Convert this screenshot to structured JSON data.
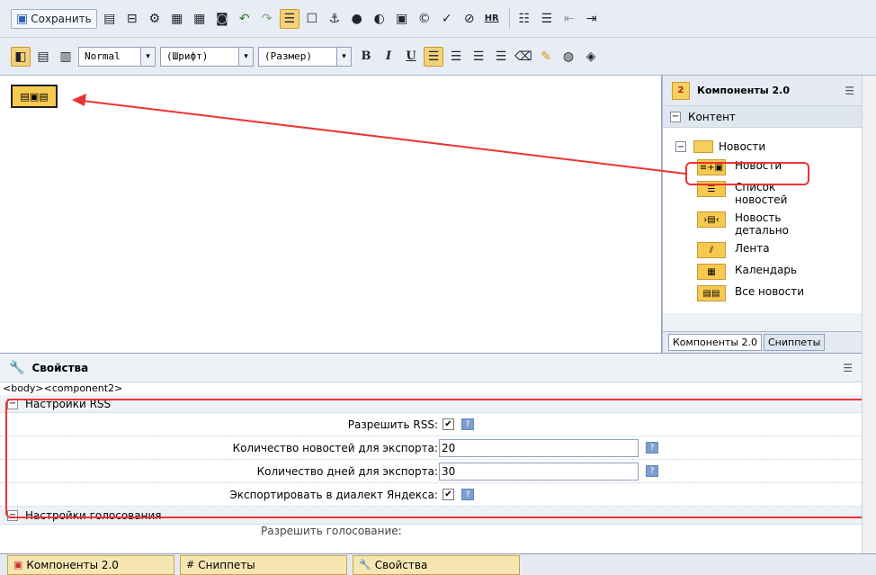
{
  "toolbar1": {
    "save_label": "Сохранить",
    "icons": [
      "snippet-icon",
      "template-icon",
      "settings-icon",
      "page-icon",
      "page-props-icon",
      "preview-icon",
      "undo-icon",
      "redo-icon",
      "component-icon",
      "table-icon",
      "anchor-icon",
      "flash-icon",
      "media-icon",
      "image-icon",
      "copyright-icon",
      "spellcheck-icon",
      "clean-icon",
      "hr-icon",
      "numbered-list-icon",
      "bulleted-list-icon",
      "outdent-icon",
      "indent-icon"
    ],
    "hr_label": "HR"
  },
  "toolbar2": {
    "style_value": "Normal",
    "font_value": "(Шрифт)",
    "size_value": "(Размер)",
    "bold": "B",
    "italic": "I",
    "underline": "U"
  },
  "component_panel": {
    "title": "Компоненты 2.0",
    "section": "Контент",
    "folder": "Новости",
    "items": [
      {
        "label": "Новости",
        "icon": "news-icon"
      },
      {
        "label": "Список новостей",
        "icon": "news-list-icon"
      },
      {
        "label": "Новость детально",
        "icon": "news-detail-icon"
      },
      {
        "label": "Лента",
        "icon": "feed-icon"
      },
      {
        "label": "Календарь",
        "icon": "calendar-icon"
      },
      {
        "label": "Все новости",
        "icon": "all-news-icon"
      }
    ],
    "tabs": [
      "Компоненты 2.0",
      "Сниппеты"
    ]
  },
  "properties": {
    "title": "Свойства",
    "path": "<body><component2>",
    "rss_group": "Настройки RSS",
    "rows": [
      {
        "label": "Разрешить RSS:",
        "type": "checkbox",
        "checked": true
      },
      {
        "label": "Количество новостей для экспорта:",
        "type": "text",
        "value": "20"
      },
      {
        "label": "Количество дней для экспорта:",
        "type": "text",
        "value": "30"
      },
      {
        "label": "Экспортировать в диалект Яндекса:",
        "type": "checkbox",
        "checked": true
      }
    ],
    "vote_group": "Настройки голосования",
    "partial_row": "Разрешить голосование:"
  },
  "bottom_tabs": [
    "Компоненты 2.0",
    "Сниппеты",
    "Свойства"
  ],
  "colors": {
    "accent": "#f6c94f",
    "highlight": "#e33333",
    "toolbar": "#e8edf5"
  }
}
